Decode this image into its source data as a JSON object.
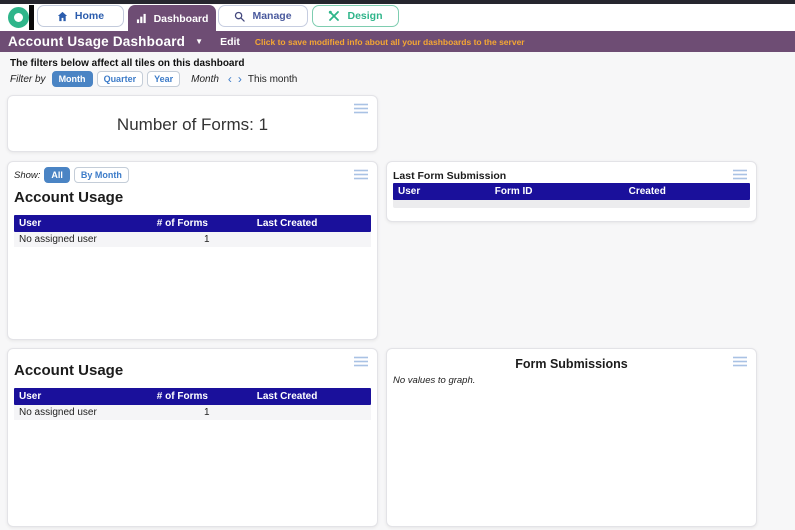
{
  "header": {
    "tabs": [
      {
        "label": "Home",
        "icon": "home-icon",
        "active": false
      },
      {
        "label": "Dashboard",
        "icon": "bar-chart-icon",
        "active": true
      },
      {
        "label": "Manage",
        "icon": "search-icon",
        "active": false
      },
      {
        "label": "Design",
        "icon": "tools-icon",
        "active": false
      }
    ],
    "title_bar": {
      "title": "Account Usage Dashboard",
      "edit_label": "Edit",
      "save_note": "Click to save modified info about all your dashboards to the server"
    }
  },
  "filters": {
    "heading": "The filters below affect all tiles on this dashboard",
    "filter_by_label": "Filter by",
    "period_buttons": [
      "Month",
      "Quarter",
      "Year"
    ],
    "active_period": "Month",
    "nav_label": "Month",
    "current_value": "This month"
  },
  "tiles": {
    "number_of_forms": {
      "text": "Number of Forms: 1"
    },
    "account_usage_1": {
      "show_label": "Show:",
      "show_buttons": [
        "All",
        "By Month"
      ],
      "active_show": "All",
      "title": "Account Usage",
      "table": {
        "headers": [
          "User",
          "# of Forms",
          "Last Created"
        ],
        "rows": [
          [
            "No assigned user",
            "1",
            ""
          ]
        ]
      }
    },
    "last_form_submission": {
      "title": "Last Form Submission",
      "table": {
        "headers": [
          "User",
          "Form ID",
          "Created"
        ],
        "rows": []
      }
    },
    "account_usage_2": {
      "title": "Account Usage",
      "table": {
        "headers": [
          "User",
          "# of Forms",
          "Last Created"
        ],
        "rows": [
          [
            "No assigned user",
            "1",
            ""
          ]
        ]
      }
    },
    "form_submissions": {
      "title": "Form Submissions",
      "empty_message": "No values to graph."
    }
  },
  "icons": {
    "caret_down": "▼",
    "chevron_left": "‹",
    "chevron_right": "›"
  },
  "colors": {
    "brand_purple": "#6e4d74",
    "table_header_navy": "#1a109b",
    "accent_blue": "#4a84c4",
    "save_note_orange": "#f5a733",
    "logo_teal": "#2fb58a",
    "tile_menu_icon_blue": "#a9c2e4"
  }
}
